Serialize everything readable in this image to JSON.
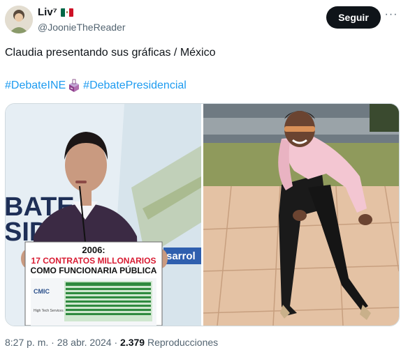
{
  "author": {
    "display_name": "Liv⁷",
    "handle": "@JoonieTheReader"
  },
  "follow_button": "Seguir",
  "more_button": "···",
  "tweet": {
    "text": "Claudia presentando sus gráficas / México",
    "hashtag_1": "#DebateINE",
    "hashtag_2": "#DebatePresidencial"
  },
  "left_image": {
    "backdrop_text_1": "BATE",
    "backdrop_text_2": "SID",
    "backdrop_text_3": "sarrol",
    "sign_line_1": "2006:",
    "sign_line_2": "17 CONTRATOS MILLONARIOS",
    "sign_line_3": "COMO FUNCIONARIA PÚBLICA",
    "doc_logo": "CMIC",
    "doc_footer": "High Tech Services"
  },
  "meta": {
    "time": "8:27 p. m.",
    "sep": "·",
    "date": "28 abr. 2024",
    "views": "2.379",
    "views_label": "Reproducciones"
  },
  "colors": {
    "hashtag": "#1d9bf0",
    "handle": "#536471",
    "button_bg": "#0f1419"
  }
}
